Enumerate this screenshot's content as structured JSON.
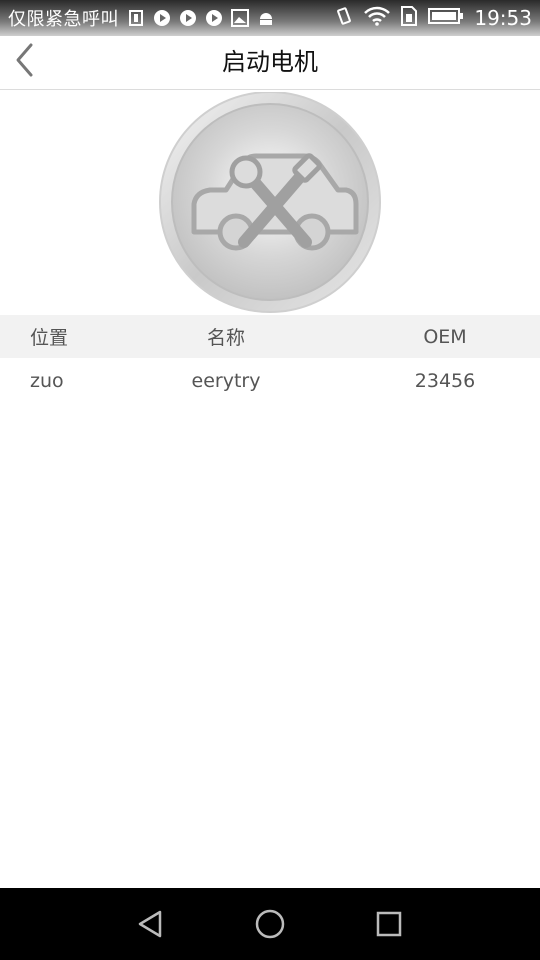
{
  "status_bar": {
    "carrier": "仅限紧急呼叫",
    "time": "19:53",
    "icons": [
      "sim-icon",
      "play-icon",
      "play-icon",
      "play-icon",
      "image-icon",
      "android-icon"
    ],
    "right_icons": [
      "vibrate-icon",
      "wifi-icon",
      "sim-card-icon",
      "battery-icon"
    ]
  },
  "header": {
    "title": "启动电机",
    "back_icon": "chevron-left-icon"
  },
  "emblem": {
    "icon": "car-repair-emblem"
  },
  "table": {
    "headers": [
      "位置",
      "名称",
      "OEM"
    ],
    "rows": [
      [
        "zuo",
        "eerytry",
        "23456"
      ]
    ]
  },
  "nav_bar": {
    "icons": [
      "back-triangle-icon",
      "home-circle-icon",
      "recents-square-icon"
    ]
  },
  "colors": {
    "header_divider": "#dcdcdc",
    "table_header_bg": "#f2f2f2",
    "text_gray": "#555555"
  }
}
